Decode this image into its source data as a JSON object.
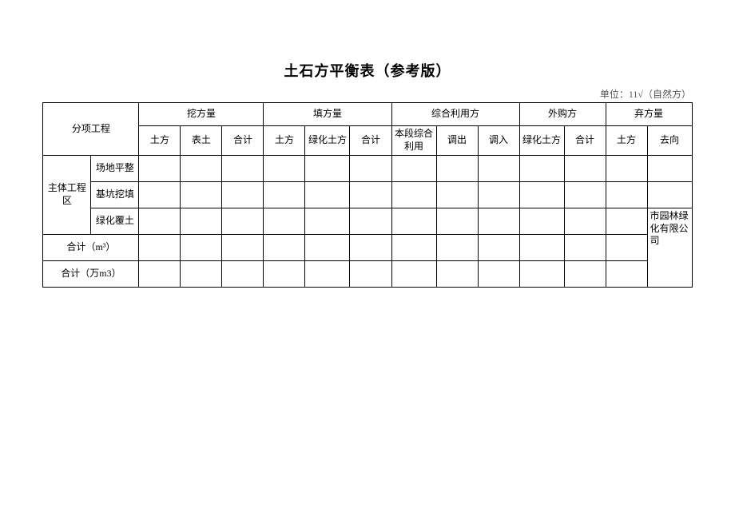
{
  "title": "土石方平衡表（参考版）",
  "unit_label": "单位：11√（自然方）",
  "headers": {
    "project": "分项工程",
    "excavation": "挖方量",
    "excavation_sub": {
      "soil": "土方",
      "topsoil": "表土",
      "total": "合计"
    },
    "fill": "填方量",
    "fill_sub": {
      "soil": "土方",
      "green_soil": "绿化土方",
      "total": "合计"
    },
    "utilize": "综合利用方",
    "utilize_sub": {
      "local": "本段综合\n利用",
      "out": "调出",
      "in": "调入"
    },
    "purchase": "外购方",
    "purchase_sub": {
      "green_soil": "绿化土方",
      "total": "合计"
    },
    "waste": "弃方量",
    "waste_sub": {
      "soil": "土方",
      "dest": "去向"
    }
  },
  "rows": {
    "main_zone": "主体工程区",
    "site_level": "场地平整",
    "pit": "基坑挖填",
    "green_cover": "绿化覆土",
    "total_m3": "合计（m³）",
    "total_wm3": "合计（万m3）"
  },
  "values": {
    "green_dest": "市园林绿化有限公司"
  }
}
